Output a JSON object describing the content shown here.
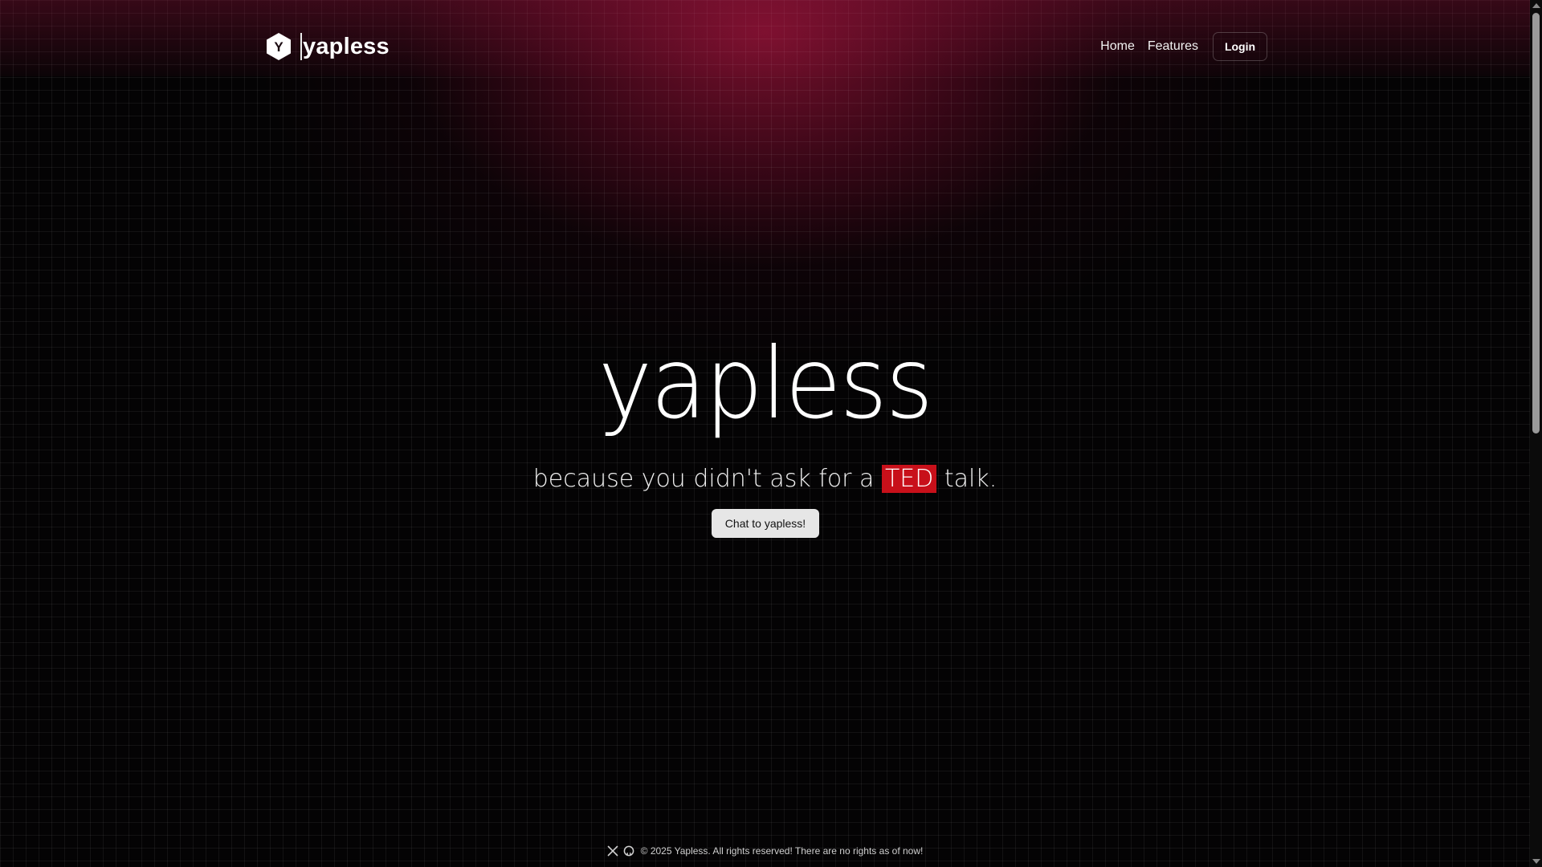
{
  "header": {
    "brand_icon_letter": "Y",
    "brand_name": "yapless",
    "nav": {
      "home": "Home",
      "features": "Features",
      "login": "Login"
    }
  },
  "hero": {
    "title": "yapless",
    "subtitle_before": "because you didn't ask for a ",
    "subtitle_highlight": "TED",
    "subtitle_after": " talk.",
    "cta_label": "Chat to yapless!"
  },
  "footer": {
    "icons": [
      "x-icon",
      "github-icon"
    ],
    "copyright": "© 2025 Yapless. All rights reserved! There are no rights as of now!"
  },
  "colors": {
    "accent": "#c8101a",
    "glow": "#8c1234",
    "background": "#040304"
  }
}
